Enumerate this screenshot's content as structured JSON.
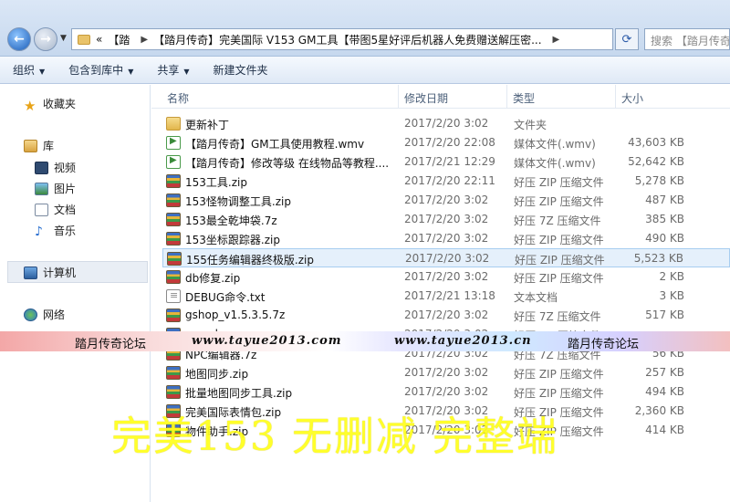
{
  "address": {
    "crumbs": [
      "«",
      "【踏",
      "【踏月传奇】完美国际 V153 GM工具【带图5星好评后机器人免费赠送解压密..."
    ],
    "search_placeholder": "搜索 【踏月传奇】"
  },
  "toolbar": {
    "organize": "组织",
    "include_library": "包含到库中",
    "share": "共享",
    "new_folder": "新建文件夹"
  },
  "sidebar": {
    "favorites": "收藏夹",
    "libraries": "库",
    "video": "视频",
    "pictures": "图片",
    "documents": "文档",
    "music": "音乐",
    "computer": "计算机",
    "network": "网络"
  },
  "columns": {
    "name": "名称",
    "date": "修改日期",
    "type": "类型",
    "size": "大小"
  },
  "files": [
    {
      "name": "更新补丁",
      "date": "2017/2/20 3:02",
      "type": "文件夹",
      "size": "",
      "icon": "folder"
    },
    {
      "name": "【踏月传奇】GM工具使用教程.wmv",
      "date": "2017/2/20 22:08",
      "type": "媒体文件(.wmv)",
      "size": "43,603 KB",
      "icon": "video"
    },
    {
      "name": "【踏月传奇】修改等级 在线物品等教程....",
      "date": "2017/2/21 12:29",
      "type": "媒体文件(.wmv)",
      "size": "52,642 KB",
      "icon": "video"
    },
    {
      "name": "153工具.zip",
      "date": "2017/2/20 22:11",
      "type": "好压 ZIP 压缩文件",
      "size": "5,278 KB",
      "icon": "zip"
    },
    {
      "name": "153怪物调整工具.zip",
      "date": "2017/2/20 3:02",
      "type": "好压 ZIP 压缩文件",
      "size": "487 KB",
      "icon": "zip"
    },
    {
      "name": "153最全乾坤袋.7z",
      "date": "2017/2/20 3:02",
      "type": "好压 7Z 压缩文件",
      "size": "385 KB",
      "icon": "7z"
    },
    {
      "name": "153坐标跟踪器.zip",
      "date": "2017/2/20 3:02",
      "type": "好压 ZIP 压缩文件",
      "size": "490 KB",
      "icon": "zip"
    },
    {
      "name": "155任务编辑器终极版.zip",
      "date": "2017/2/20 3:02",
      "type": "好压 ZIP 压缩文件",
      "size": "5,523 KB",
      "icon": "zip"
    },
    {
      "name": "db修复.zip",
      "date": "2017/2/20 3:02",
      "type": "好压 ZIP 压缩文件",
      "size": "2 KB",
      "icon": "zip"
    },
    {
      "name": "DEBUG命令.txt",
      "date": "2017/2/21 13:18",
      "type": "文本文档",
      "size": "3 KB",
      "icon": "txt"
    },
    {
      "name": "gshop_v1.5.3.5.7z",
      "date": "2017/2/20 3:02",
      "type": "好压 7Z 压缩文件",
      "size": "517 KB",
      "icon": "7z"
    },
    {
      "name": "mysql",
      "date": "2017/2/20 3:02",
      "type": "好压 7Z 压缩文件",
      "size": "",
      "icon": "7z"
    },
    {
      "name": "NPC编辑器.7z",
      "date": "2017/2/20 3:02",
      "type": "好压 7Z 压缩文件",
      "size": "56 KB",
      "icon": "7z"
    },
    {
      "name": "地图同步.zip",
      "date": "2017/2/20 3:02",
      "type": "好压 ZIP 压缩文件",
      "size": "257 KB",
      "icon": "zip"
    },
    {
      "name": "批量地图同步工具.zip",
      "date": "2017/2/20 3:02",
      "type": "好压 ZIP 压缩文件",
      "size": "494 KB",
      "icon": "zip"
    },
    {
      "name": "完美国际表情包.zip",
      "date": "2017/2/20 3:02",
      "type": "好压 ZIP 压缩文件",
      "size": "2,360 KB",
      "icon": "zip"
    },
    {
      "name": "物件助手.zip",
      "date": "2017/2/20 3:02",
      "type": "好压 ZIP 压缩文件",
      "size": "414 KB",
      "icon": "zip"
    }
  ],
  "selected_index": 7,
  "watermark": {
    "left_name": "踏月传奇论坛",
    "url1": "www.tayue2013.com",
    "url2": "www.tayue2013.cn",
    "right_name": "踏月传奇论坛",
    "overlay": "完美153 无删减 完整端"
  }
}
